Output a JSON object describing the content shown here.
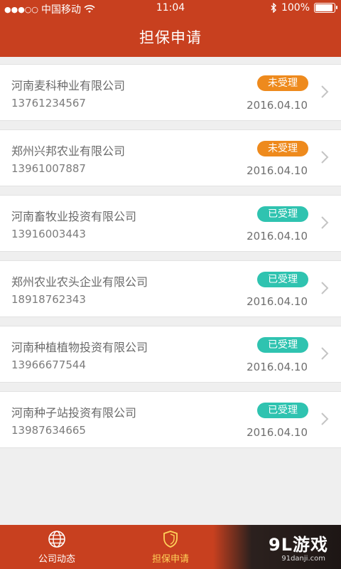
{
  "status_bar": {
    "signal": "●●●○○",
    "carrier": "中国移动",
    "time": "11:04",
    "battery_text": "100%"
  },
  "header": {
    "title": "担保申请"
  },
  "applications": [
    {
      "company": "河南麦科种业有限公司",
      "phone": "13761234567",
      "status": "未受理",
      "date": "2016.04.10"
    },
    {
      "company": "郑州兴邦农业有限公司",
      "phone": "13961007887",
      "status": "未受理",
      "date": "2016.04.10"
    },
    {
      "company": "河南畜牧业投资有限公司",
      "phone": "13916003443",
      "status": "已受理",
      "date": "2016.04.10"
    },
    {
      "company": "郑州农业农头企业有限公司",
      "phone": "18918762343",
      "status": "已受理",
      "date": "2016.04.10"
    },
    {
      "company": "河南种植植物投资有限公司",
      "phone": "13966677544",
      "status": "已受理",
      "date": "2016.04.10"
    },
    {
      "company": "河南种子站投资有限公司",
      "phone": "13987634665",
      "status": "已受理",
      "date": "2016.04.10"
    }
  ],
  "tab_bar": {
    "tabs": [
      {
        "label": "公司动态",
        "icon": "globe-icon"
      },
      {
        "label": "担保申请",
        "icon": "shield-icon"
      }
    ]
  },
  "watermark": {
    "logo": "9L游戏",
    "site": "91danji.com"
  },
  "colors": {
    "brand": "#c8401f",
    "pending": "#ee8a1d",
    "accepted": "#2fc3b0",
    "active_tab": "#ffd35a"
  }
}
